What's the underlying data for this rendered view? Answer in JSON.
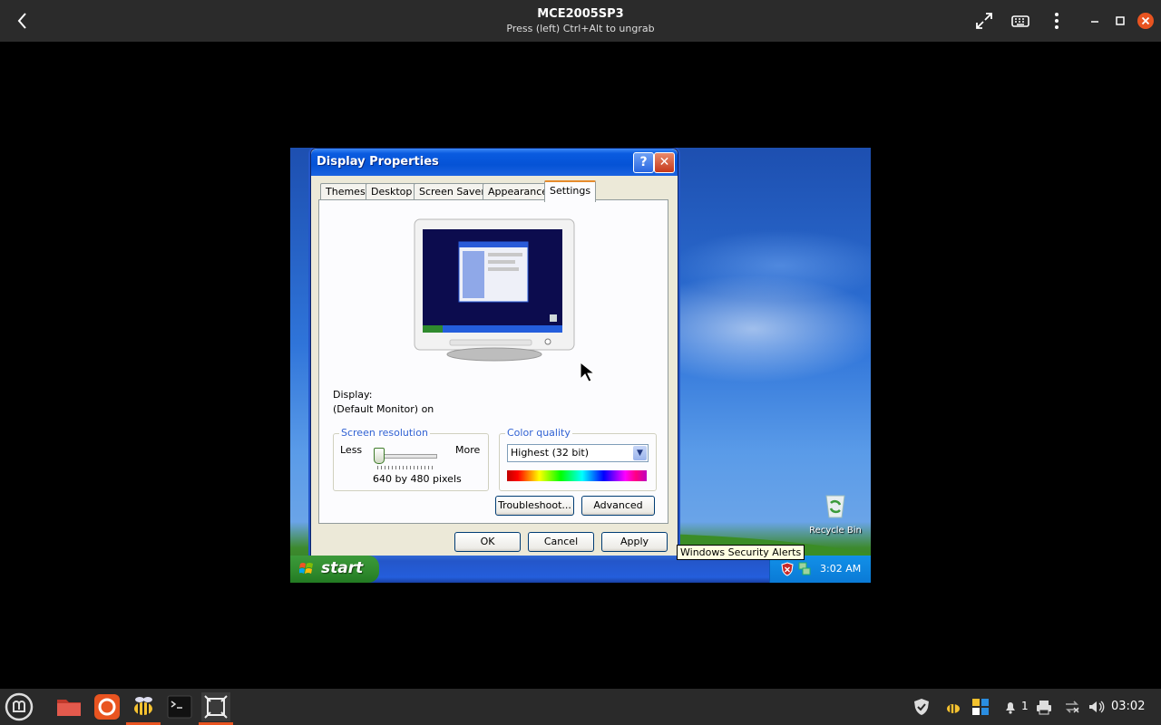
{
  "host": {
    "title": "MCE2005SP3",
    "subtitle": "Press (left) Ctrl+Alt to ungrab",
    "icons": [
      "back-arrow-icon",
      "fullscreen-icon",
      "keyboard-icon",
      "kebab-menu-icon",
      "minimize-icon",
      "maximize-icon",
      "close-icon"
    ]
  },
  "dialog": {
    "title": "Display Properties",
    "help_label": "?",
    "close_label": "✕",
    "tabs": [
      "Themes",
      "Desktop",
      "Screen Saver",
      "Appearance",
      "Settings"
    ],
    "active_tab": "Settings",
    "display_label": "Display:",
    "display_value": "(Default Monitor) on",
    "resolution": {
      "group_label": "Screen resolution",
      "less": "Less",
      "more": "More",
      "value_text": "640 by 480 pixels",
      "slider_position": 0
    },
    "color_quality": {
      "group_label": "Color quality",
      "selected": "Highest (32 bit)"
    },
    "buttons": {
      "troubleshoot": "Troubleshoot...",
      "advanced": "Advanced",
      "ok": "OK",
      "cancel": "Cancel",
      "apply": "Apply"
    }
  },
  "desktop": {
    "recycle_bin": "Recycle Bin",
    "tooltip": "Windows Security Alerts",
    "start_label": "start",
    "clock": "3:02 AM"
  },
  "host_taskbar": {
    "apps": [
      "mint-menu-icon",
      "folder-icon",
      "firefox-icon",
      "bee-icon",
      "terminal-icon",
      "vm-window-icon"
    ],
    "notification_count": "1",
    "clock": "03:02"
  },
  "colors": {
    "xp_titlebar": "#0553d6",
    "xp_start": "#2f8a2d",
    "host_bg": "#2b2b2b",
    "active_tab_accent": "#e68b2c"
  }
}
